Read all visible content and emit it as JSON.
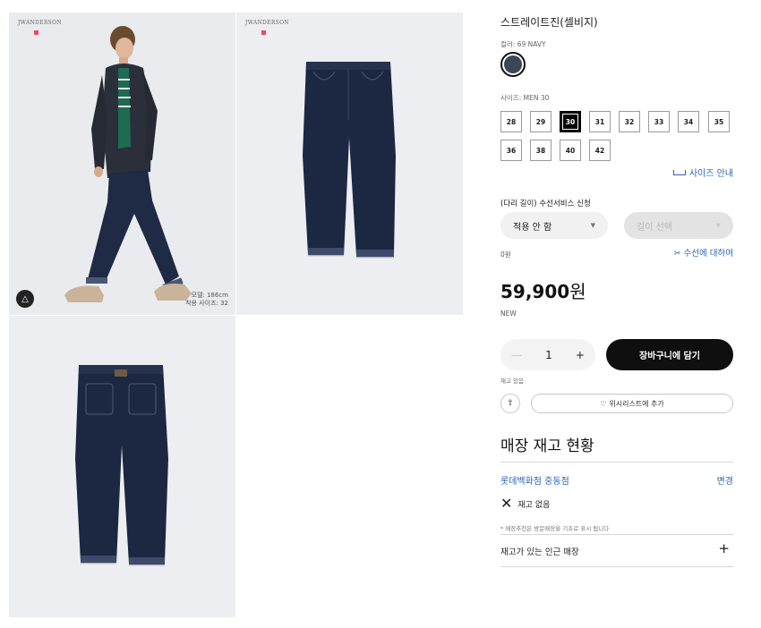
{
  "gallery": {
    "brand": "JWANDERSON",
    "model_height": "모델: 186cm",
    "model_size": "착용 사이즈: 32",
    "hanger_icon": "hanger-icon"
  },
  "product": {
    "title": "스트레이트진(셀비지)",
    "color_label": "컬러: 69 NAVY",
    "color_hex": "#3b4656",
    "size_label": "사이즈: MEN 30",
    "sizes": [
      "28",
      "29",
      "30",
      "31",
      "32",
      "33",
      "34",
      "35",
      "36",
      "38",
      "40",
      "42"
    ],
    "selected_size": "30",
    "size_guide": "사이즈 안내",
    "hem_title": "(다리 길이) 수선서비스 신청",
    "hem_option": "적용 안 함",
    "length_placeholder": "길이 선택",
    "hem_price": "0원",
    "hem_about": "수선에 대하여",
    "price": "59,900",
    "currency": "원",
    "badge": "NEW",
    "quantity": "1",
    "add_to_cart": "장바구니에 담기",
    "stock_note": "재고 있음",
    "wishlist": "위시리스트에 추가"
  },
  "store": {
    "title": "매장 재고 현황",
    "name": "롯데백화점 중동점",
    "change": "변경",
    "availability": "재고 없음",
    "disclaimer": "* 매장추천은 방문매장을 기초로 표시 됩니다",
    "nearby": "재고가 있는 인근 매장"
  },
  "colors": {
    "link": "#2b63b5",
    "primary": "#0f0f0f"
  }
}
